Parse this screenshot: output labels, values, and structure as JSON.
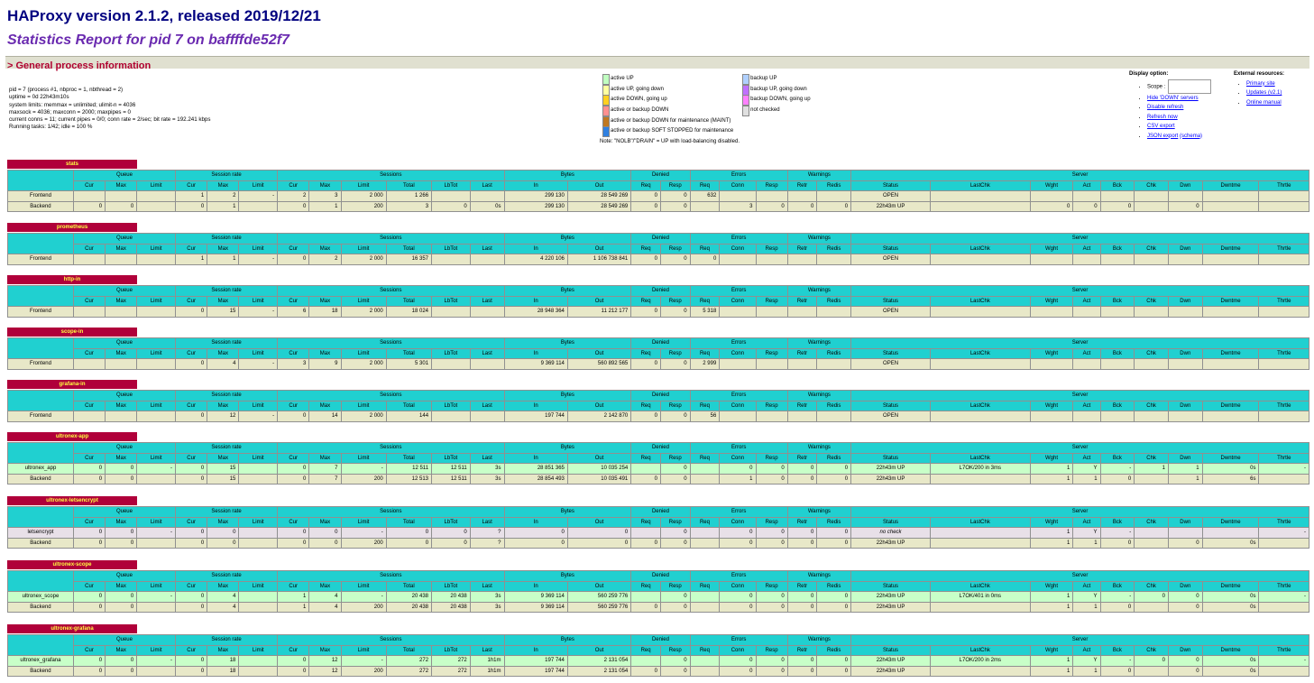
{
  "header": {
    "title": "HAProxy version 2.1.2, released 2019/12/21",
    "subtitle": "Statistics Report for pid 7 on baffffde52f7"
  },
  "general": {
    "bar_label": "> General process information",
    "lines": [
      "pid = 7 (process #1, nbproc = 1, nbthread = 2)",
      "uptime = 0d 22h43m10s",
      "system limits: memmax = unlimited; ulimit-n = 4036",
      "maxsock = 4036; maxconn = 2000; maxpipes = 0",
      "current conns = 11; current pipes = 0/0; conn rate = 2/sec; bit rate = 192.241 kbps",
      "Running tasks: 1/42; idle = 100 %"
    ]
  },
  "legend": {
    "items": [
      {
        "label": "active UP",
        "color": "#c0ffc0"
      },
      {
        "label": "active UP, going down",
        "color": "#ffffa0"
      },
      {
        "label": "active DOWN, going up",
        "color": "#ffd020"
      },
      {
        "label": "active or backup DOWN",
        "color": "#ff9090"
      },
      {
        "label": "active or backup DOWN for maintenance (MAINT)",
        "color": "#c07820"
      },
      {
        "label": "active or backup SOFT STOPPED for maintenance",
        "color": "#3080e0"
      }
    ],
    "items2": [
      {
        "label": "backup UP",
        "color": "#b0d0ff"
      },
      {
        "label": "backup UP, going down",
        "color": "#c070ff"
      },
      {
        "label": "backup DOWN, going up",
        "color": "#ff80ff"
      },
      {
        "label": "not checked",
        "color": "#e0e0e0"
      }
    ],
    "note": "Note: \"NOLB\"/\"DRAIN\" = UP with load-balancing disabled."
  },
  "display": {
    "title": "Display option:",
    "scope_label": "Scope :",
    "links": [
      "Hide 'DOWN' servers",
      "Disable refresh",
      "Refresh now",
      "CSV export",
      "JSON export"
    ],
    "schema": "(schema)"
  },
  "external": {
    "title": "External resources:",
    "links": [
      "Primary site",
      "Updates (v2.1)",
      "Online manual"
    ]
  },
  "columns": {
    "groups": [
      "Queue",
      "Session rate",
      "Sessions",
      "Bytes",
      "Denied",
      "Errors",
      "Warnings",
      "Server"
    ],
    "subs": [
      "Cur",
      "Max",
      "Limit",
      "Cur",
      "Max",
      "Limit",
      "Cur",
      "Max",
      "Limit",
      "Total",
      "LbTot",
      "Last",
      "In",
      "Out",
      "Req",
      "Resp",
      "Req",
      "Conn",
      "Resp",
      "Retr",
      "Redis",
      "Status",
      "LastChk",
      "Wght",
      "Act",
      "Bck",
      "Chk",
      "Dwn",
      "Dwntme",
      "Thrtle"
    ]
  },
  "proxies": [
    {
      "name": "stats",
      "rows": [
        {
          "kind": "fe",
          "cells": [
            "Frontend",
            "",
            "",
            "",
            "1",
            "2",
            "-",
            "2",
            "3",
            "2 000",
            "1 266",
            "",
            "",
            "299 130",
            "28 549 269",
            "0",
            "0",
            "632",
            "",
            "",
            "",
            "",
            "OPEN",
            "",
            "",
            "",
            "",
            "",
            "",
            "",
            ""
          ]
        },
        {
          "kind": "be",
          "cells": [
            "Backend",
            "0",
            "0",
            "",
            "0",
            "1",
            "",
            "0",
            "1",
            "200",
            "3",
            "0",
            "0s",
            "299 130",
            "28 549 269",
            "0",
            "0",
            "",
            "3",
            "0",
            "0",
            "0",
            "22h43m UP",
            "",
            "0",
            "0",
            "0",
            "",
            "0",
            "",
            ""
          ]
        }
      ]
    },
    {
      "name": "prometheus",
      "rows": [
        {
          "kind": "fe",
          "cells": [
            "Frontend",
            "",
            "",
            "",
            "1",
            "1",
            "-",
            "0",
            "2",
            "2 000",
            "16 357",
            "",
            "",
            "4 220 106",
            "1 106 738 841",
            "0",
            "0",
            "0",
            "",
            "",
            "",
            "",
            "OPEN",
            "",
            "",
            "",
            "",
            "",
            "",
            "",
            ""
          ]
        }
      ]
    },
    {
      "name": "http-in",
      "rows": [
        {
          "kind": "fe",
          "cells": [
            "Frontend",
            "",
            "",
            "",
            "0",
            "15",
            "-",
            "6",
            "18",
            "2 000",
            "18 024",
            "",
            "",
            "28 948 364",
            "11 212 177",
            "0",
            "0",
            "5 318",
            "",
            "",
            "",
            "",
            "OPEN",
            "",
            "",
            "",
            "",
            "",
            "",
            "",
            ""
          ]
        }
      ]
    },
    {
      "name": "scope-in",
      "rows": [
        {
          "kind": "fe",
          "cells": [
            "Frontend",
            "",
            "",
            "",
            "0",
            "4",
            "-",
            "3",
            "9",
            "2 000",
            "5 301",
            "",
            "",
            "9 369 114",
            "560 892 565",
            "0",
            "0",
            "2 999",
            "",
            "",
            "",
            "",
            "OPEN",
            "",
            "",
            "",
            "",
            "",
            "",
            "",
            ""
          ]
        }
      ]
    },
    {
      "name": "grafana-in",
      "rows": [
        {
          "kind": "fe",
          "cells": [
            "Frontend",
            "",
            "",
            "",
            "0",
            "12",
            "-",
            "0",
            "14",
            "2 000",
            "144",
            "",
            "",
            "197 744",
            "2 142 870",
            "0",
            "0",
            "56",
            "",
            "",
            "",
            "",
            "OPEN",
            "",
            "",
            "",
            "",
            "",
            "",
            "",
            ""
          ]
        }
      ]
    },
    {
      "name": "ultronex-app",
      "rows": [
        {
          "kind": "up",
          "cells": [
            "ultronex_app",
            "0",
            "0",
            "-",
            "0",
            "15",
            "",
            "0",
            "7",
            "-",
            "12 511",
            "12 511",
            "3s",
            "28 851 365",
            "10 035 254",
            "",
            "0",
            "",
            "0",
            "0",
            "0",
            "0",
            "22h43m UP",
            "L7OK/200 in 3ms",
            "1",
            "Y",
            "-",
            "1",
            "1",
            "0s",
            "-"
          ]
        },
        {
          "kind": "be",
          "cells": [
            "Backend",
            "0",
            "0",
            "",
            "0",
            "15",
            "",
            "0",
            "7",
            "200",
            "12 513",
            "12 511",
            "3s",
            "28 854 493",
            "10 035 491",
            "0",
            "0",
            "",
            "1",
            "0",
            "0",
            "0",
            "22h43m UP",
            "",
            "1",
            "1",
            "0",
            "",
            "1",
            "6s",
            ""
          ]
        }
      ]
    },
    {
      "name": "ultronex-letsencrypt",
      "rows": [
        {
          "kind": "nc",
          "cells": [
            "letsencrypt",
            "0",
            "0",
            "-",
            "0",
            "0",
            "",
            "0",
            "0",
            "-",
            "0",
            "0",
            "?",
            "0",
            "0",
            "",
            "0",
            "",
            "0",
            "0",
            "0",
            "0",
            "no check",
            "",
            "1",
            "Y",
            "-",
            "",
            "",
            "",
            "-"
          ]
        },
        {
          "kind": "be",
          "cells": [
            "Backend",
            "0",
            "0",
            "",
            "0",
            "0",
            "",
            "0",
            "0",
            "200",
            "0",
            "0",
            "?",
            "0",
            "0",
            "0",
            "0",
            "",
            "0",
            "0",
            "0",
            "0",
            "22h43m UP",
            "",
            "1",
            "1",
            "0",
            "",
            "0",
            "0s",
            ""
          ]
        }
      ]
    },
    {
      "name": "ultronex-scope",
      "rows": [
        {
          "kind": "up",
          "cells": [
            "ultronex_scope",
            "0",
            "0",
            "-",
            "0",
            "4",
            "",
            "1",
            "4",
            "-",
            "20 438",
            "20 438",
            "3s",
            "9 369 114",
            "560 259 776",
            "",
            "0",
            "",
            "0",
            "0",
            "0",
            "0",
            "22h43m UP",
            "L7OK/401 in 0ms",
            "1",
            "Y",
            "-",
            "0",
            "0",
            "0s",
            "-"
          ]
        },
        {
          "kind": "be",
          "cells": [
            "Backend",
            "0",
            "0",
            "",
            "0",
            "4",
            "",
            "1",
            "4",
            "200",
            "20 438",
            "20 438",
            "3s",
            "9 369 114",
            "560 259 776",
            "0",
            "0",
            "",
            "0",
            "0",
            "0",
            "0",
            "22h43m UP",
            "",
            "1",
            "1",
            "0",
            "",
            "0",
            "0s",
            ""
          ]
        }
      ]
    },
    {
      "name": "ultronex-grafana",
      "rows": [
        {
          "kind": "up",
          "cells": [
            "ultronex_grafana",
            "0",
            "0",
            "-",
            "0",
            "18",
            "",
            "0",
            "12",
            "-",
            "272",
            "272",
            "1h1m",
            "197 744",
            "2 131 054",
            "",
            "0",
            "",
            "0",
            "0",
            "0",
            "0",
            "22h43m UP",
            "L7OK/200 in 2ms",
            "1",
            "Y",
            "-",
            "0",
            "0",
            "0s",
            "-"
          ]
        },
        {
          "kind": "be",
          "cells": [
            "Backend",
            "0",
            "0",
            "",
            "0",
            "18",
            "",
            "0",
            "12",
            "200",
            "272",
            "272",
            "1h1m",
            "197 744",
            "2 131 054",
            "0",
            "0",
            "",
            "0",
            "0",
            "0",
            "0",
            "22h43m UP",
            "",
            "1",
            "1",
            "0",
            "",
            "0",
            "0s",
            ""
          ]
        }
      ]
    }
  ]
}
